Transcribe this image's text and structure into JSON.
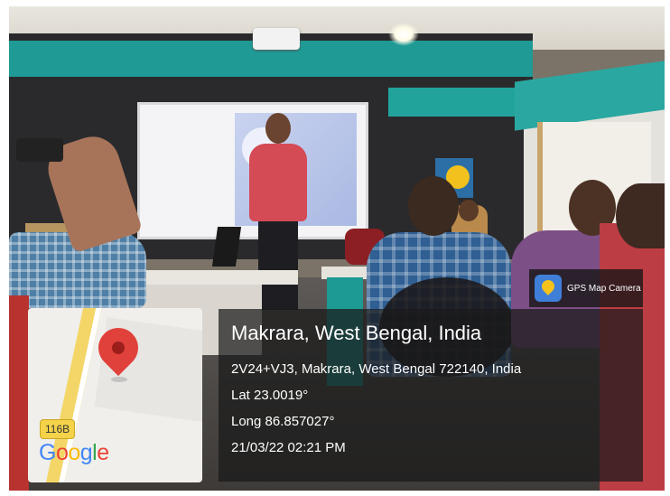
{
  "badge": {
    "label": "GPS Map Camera",
    "icon": "gps-map-camera-icon"
  },
  "map": {
    "route_label": "116B",
    "logo_text": "Google",
    "pin_icon": "map-pin-icon"
  },
  "location": {
    "title": "Makrara, West Bengal, India",
    "address": "2V24+VJ3, Makrara, West Bengal 722140, India",
    "lat": "Lat 23.0019°",
    "long": "Long 86.857027°",
    "datetime": "21/03/22 02:21 PM"
  },
  "colors": {
    "pin": "#e0413b",
    "road": "#f3d667",
    "panel": "#191919",
    "teal_wall": "#1f9a95"
  }
}
